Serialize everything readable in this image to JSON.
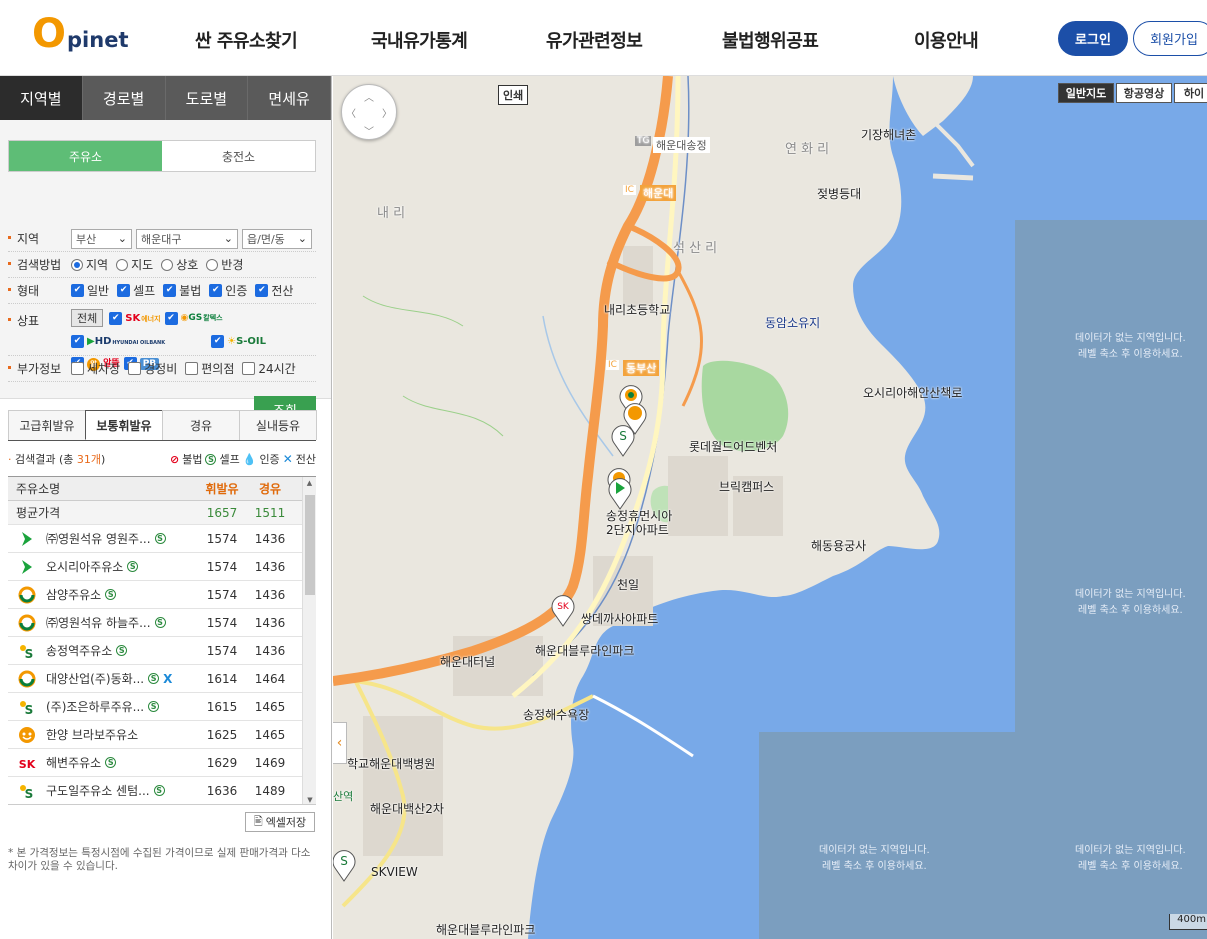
{
  "header": {
    "logo_o": "O",
    "logo_rest": "pinet",
    "nav": [
      "싼 주유소찾기",
      "국내유가통계",
      "유가관련정보",
      "불법행위공표",
      "이용안내"
    ],
    "login": "로그인",
    "join": "회원가입"
  },
  "panel": {
    "tabs": [
      "지역별",
      "경로별",
      "도로별",
      "면세유"
    ],
    "subtabs": [
      "주유소",
      "충전소"
    ],
    "region_label": "지역",
    "region_values": [
      "부산",
      "해운대구",
      "읍/면/동"
    ],
    "method_label": "검색방법",
    "method_options": [
      "지역",
      "지도",
      "상호",
      "반경"
    ],
    "type_label": "형태",
    "type_options": [
      "일반",
      "셀프",
      "불법",
      "인증",
      "전산"
    ],
    "brand_label": "상표",
    "brand_all": "전체",
    "brands": [
      "SK에너지",
      "GS칼텍스",
      "HD현대오일뱅크",
      "S-OIL",
      "알뜰",
      "PB"
    ],
    "extra_label": "부가정보",
    "extra_options": [
      "세차장",
      "경정비",
      "편의점",
      "24시간"
    ],
    "search_button": "조회",
    "fuel_tabs": [
      "고급휘발유",
      "보통휘발유",
      "경유",
      "실내등유"
    ],
    "result_prefix": "검색결과 (총 ",
    "result_count": "31개",
    "result_suffix": ")",
    "legend": [
      "불법",
      "셀프",
      "인증",
      "전산"
    ],
    "table_headers": [
      "주유소명",
      "휘발유",
      "경유"
    ],
    "avg": {
      "name": "평균가격",
      "gas": "1657",
      "diesel": "1511"
    },
    "rows": [
      {
        "brand": "hd",
        "name": "㈜영원석유 영원주...",
        "gas": "1574",
        "diesel": "1436"
      },
      {
        "brand": "hd",
        "name": "오시리아주유소",
        "gas": "1574",
        "diesel": "1436"
      },
      {
        "brand": "gs",
        "name": "삼양주유소",
        "gas": "1574",
        "diesel": "1436"
      },
      {
        "brand": "gs",
        "name": "㈜영원석유 하늘주...",
        "gas": "1574",
        "diesel": "1436"
      },
      {
        "brand": "soil",
        "name": "송정역주유소",
        "gas": "1574",
        "diesel": "1436"
      },
      {
        "brand": "gs",
        "name": "대양산업(주)동화...",
        "gas": "1614",
        "diesel": "1464"
      },
      {
        "brand": "soil",
        "name": "(주)조은하루주유...",
        "gas": "1615",
        "diesel": "1465"
      },
      {
        "brand": "altteul",
        "name": "한양 브라보주유소",
        "gas": "1625",
        "diesel": "1465"
      },
      {
        "brand": "sk",
        "name": "해변주유소",
        "gas": "1629",
        "diesel": "1469"
      },
      {
        "brand": "soil",
        "name": "구도일주유소 센텀...",
        "gas": "1636",
        "diesel": "1489"
      }
    ],
    "excel_button": "엑셀저장",
    "note": "* 본 가격정보는 특정시점에 수집된 가격이므로 실제 판매가격과 다소 차이가 있을 수 있습니다."
  },
  "map": {
    "types": [
      "일반지도",
      "항공영상",
      "하이"
    ],
    "print": "인쇄",
    "nodata_line1": "데이터가 없는 지역입니다.",
    "nodata_line2": "레벨 축소 후 이용하세요.",
    "scale": "400m",
    "labels": [
      {
        "text": "기장해녀촌"
      },
      {
        "text": "연 화 리"
      },
      {
        "text": "젖병등대"
      },
      {
        "text": "내 리"
      },
      {
        "text": "석 산 리"
      },
      {
        "text": "해운대송정"
      },
      {
        "text": "해운대"
      },
      {
        "text": "내리초등학교"
      },
      {
        "text": "동암소유지"
      },
      {
        "text": "동부산"
      },
      {
        "text": "오시리아해안산책로"
      },
      {
        "text": "롯데월드어드벤처"
      },
      {
        "text": "브릭캠퍼스"
      },
      {
        "text": "송정휴먼시아"
      },
      {
        "text": "2단지아파트"
      },
      {
        "text": "해동용궁사"
      },
      {
        "text": "천일"
      },
      {
        "text": "쌍데까사아파트"
      },
      {
        "text": "해운대블루라인파크"
      },
      {
        "text": "해운대터널"
      },
      {
        "text": "송정해수욕장"
      },
      {
        "text": "학교해운대백병원"
      },
      {
        "text": "해운대백산2차"
      },
      {
        "text": "SKVIEW"
      },
      {
        "text": "해운대블루라인파크"
      },
      {
        "text": "TG"
      },
      {
        "text": "IC"
      },
      {
        "text": "IC"
      },
      {
        "text": "산역"
      }
    ]
  },
  "colors": {
    "accent": "#1c4fa8",
    "orange": "#f39800",
    "green": "#5ebd76",
    "sea": "#78a9e8",
    "nodata": "#7b9ebf",
    "road": "#f59b4c"
  }
}
